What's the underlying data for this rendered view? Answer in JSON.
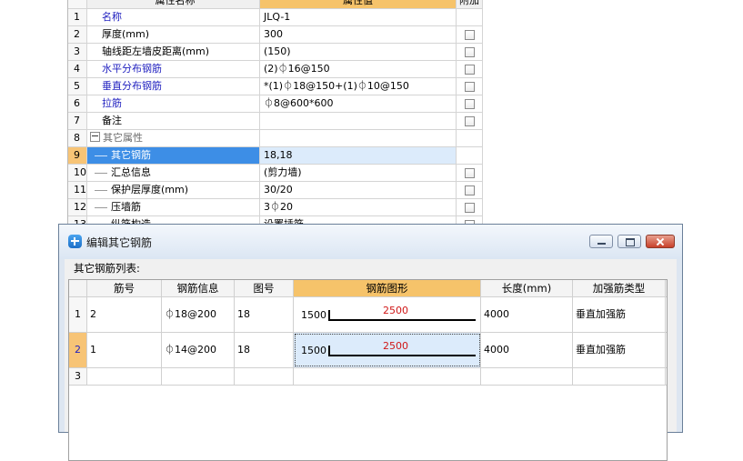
{
  "property_grid": {
    "header": {
      "name": "属性名称",
      "value": "属性值",
      "add": "附加"
    },
    "rows": [
      {
        "num": "1",
        "name": "名称",
        "value": "JLQ-1",
        "checkbox": false
      },
      {
        "num": "2",
        "name": "厚度(mm)",
        "value": "300",
        "checkbox": true
      },
      {
        "num": "3",
        "name": "轴线距左墙皮距离(mm)",
        "value": "(150)",
        "checkbox": true
      },
      {
        "num": "4",
        "name": "水平分布钢筋",
        "value": "(2)⏀16@150",
        "checkbox": true
      },
      {
        "num": "5",
        "name": "垂直分布钢筋",
        "value": "*(1)⏀18@150+(1)⏀10@150",
        "checkbox": true
      },
      {
        "num": "6",
        "name": "拉筋",
        "value": "⏀8@600*600",
        "checkbox": true
      },
      {
        "num": "7",
        "name": "备注",
        "value": "",
        "checkbox": true
      },
      {
        "num": "8",
        "name": "其它属性",
        "value": "",
        "checkbox": false
      },
      {
        "num": "9",
        "name": "其它钢筋",
        "value": "18,18",
        "checkbox": false
      },
      {
        "num": "10",
        "name": "汇总信息",
        "value": "(剪力墙)",
        "checkbox": true
      },
      {
        "num": "11",
        "name": "保护层厚度(mm)",
        "value": "30/20",
        "checkbox": true
      },
      {
        "num": "12",
        "name": "压墙筋",
        "value": "3⏀20",
        "checkbox": true
      },
      {
        "num": "13",
        "name": "纵筋构造",
        "value": "设置插筋",
        "checkbox": true
      }
    ]
  },
  "dialog": {
    "title": "编辑其它钢筋",
    "list_label": "其它钢筋列表:",
    "columns": [
      "",
      "筋号",
      "钢筋信息",
      "图号",
      "钢筋图形",
      "长度(mm)",
      "加强筋类型"
    ],
    "rows": [
      {
        "num": "1",
        "bar_no": "2",
        "info": "⏀18@200",
        "fig": "18",
        "shape_left": "1500",
        "shape_len": "2500",
        "length": "4000",
        "type": "垂直加强筋"
      },
      {
        "num": "2",
        "bar_no": "1",
        "info": "⏀14@200",
        "fig": "18",
        "shape_left": "1500",
        "shape_len": "2500",
        "length": "4000",
        "type": "垂直加强筋"
      }
    ],
    "empty_row_num": "3"
  }
}
